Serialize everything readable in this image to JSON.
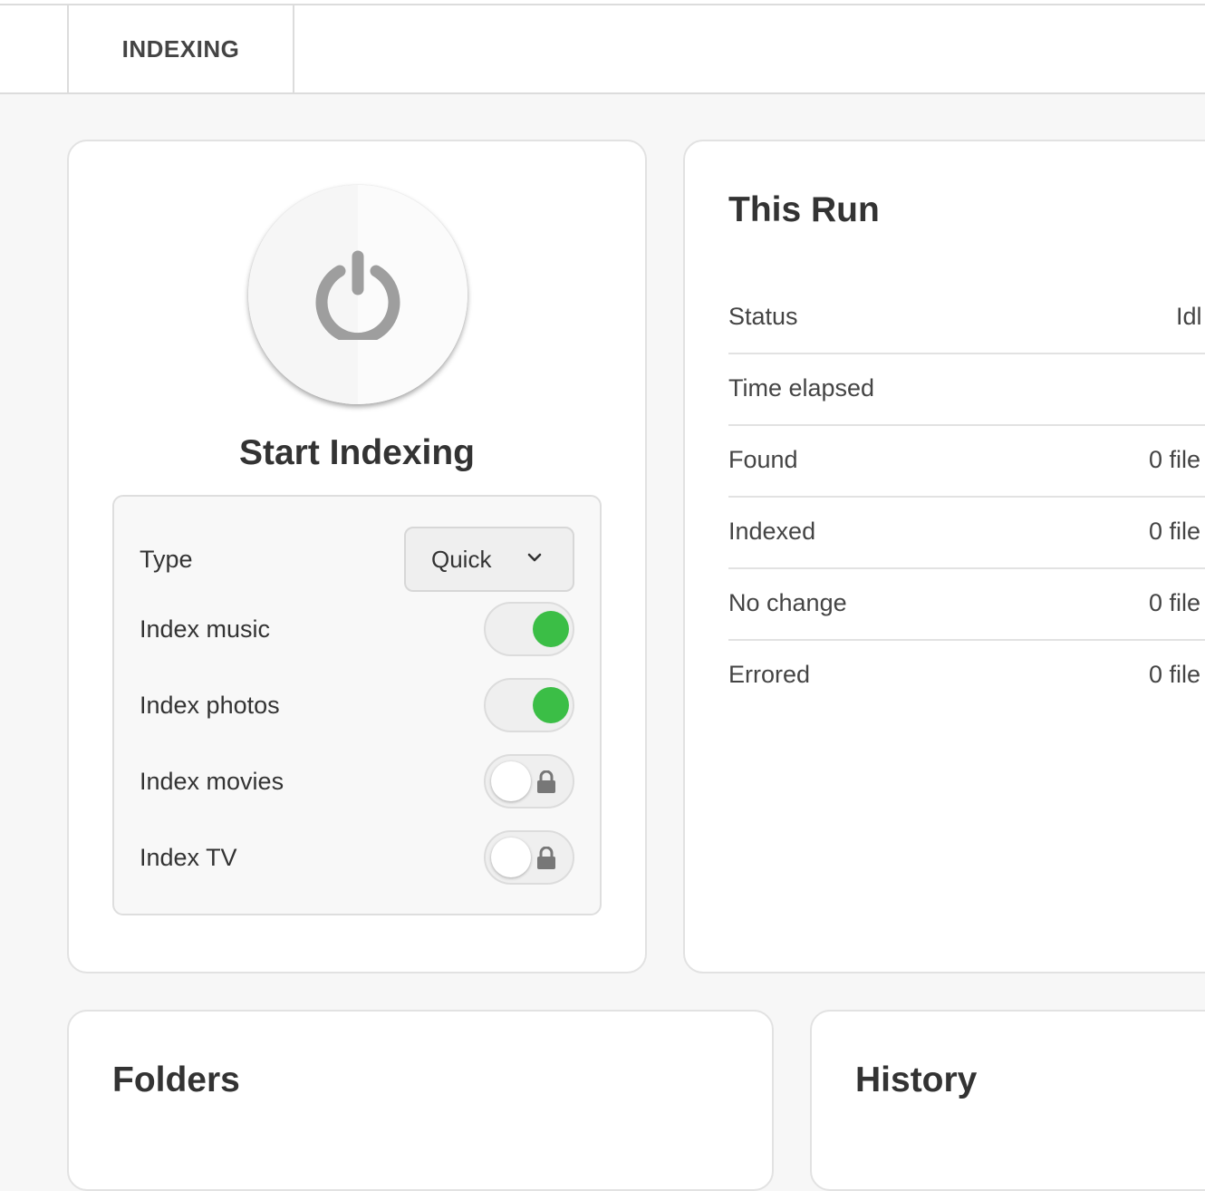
{
  "tabs": [
    {
      "label": "INDEXING"
    }
  ],
  "start_card": {
    "title": "Start Indexing",
    "options": {
      "type": {
        "label": "Type",
        "value": "Quick"
      },
      "toggles": [
        {
          "label": "Index music",
          "on": true,
          "locked": false
        },
        {
          "label": "Index photos",
          "on": true,
          "locked": false
        },
        {
          "label": "Index movies",
          "on": false,
          "locked": true
        },
        {
          "label": "Index TV",
          "on": false,
          "locked": true
        }
      ]
    }
  },
  "run_card": {
    "title": "This Run",
    "stats": [
      {
        "label": "Status",
        "value": "Idl"
      },
      {
        "label": "Time elapsed",
        "value": ""
      },
      {
        "label": "Found",
        "value": "0 file"
      },
      {
        "label": "Indexed",
        "value": "0 file"
      },
      {
        "label": "No change",
        "value": "0 file"
      },
      {
        "label": "Errored",
        "value": "0 file"
      }
    ]
  },
  "folders_card": {
    "title": "Folders"
  },
  "history_card": {
    "title": "History"
  },
  "colors": {
    "accent_green": "#3bbe46",
    "icon_gray": "#9e9e9e"
  }
}
